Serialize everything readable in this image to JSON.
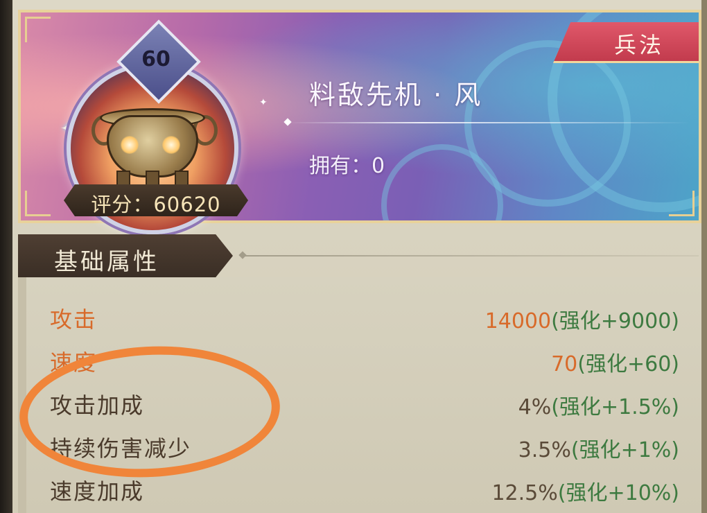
{
  "card": {
    "category_tag": "兵法",
    "item_name": "料敌先机 · 风",
    "owned_text": "拥有：0",
    "level": "60",
    "score_text": "评分：60620",
    "item_icon": "cauldron-icon"
  },
  "section": {
    "title": "基础属性"
  },
  "stats": [
    {
      "label": "攻击",
      "base": "14000",
      "bonus": "(强化+9000)",
      "highlighted": true
    },
    {
      "label": "速度",
      "base": "70",
      "bonus": "(强化+60)",
      "highlighted": true
    },
    {
      "label": "攻击加成",
      "base": "4%",
      "bonus": "(强化+1.5%)",
      "highlighted": false
    },
    {
      "label": "持续伤害减少",
      "base": "3.5%",
      "bonus": "(强化+1%)",
      "highlighted": false
    },
    {
      "label": "速度加成",
      "base": "12.5%",
      "bonus": "(强化+10%)",
      "highlighted": false
    }
  ],
  "colors": {
    "highlight": "#d86a2a",
    "bonus": "#3d7a40",
    "annotation": "#f0853a",
    "tag": "#c23b4d"
  }
}
